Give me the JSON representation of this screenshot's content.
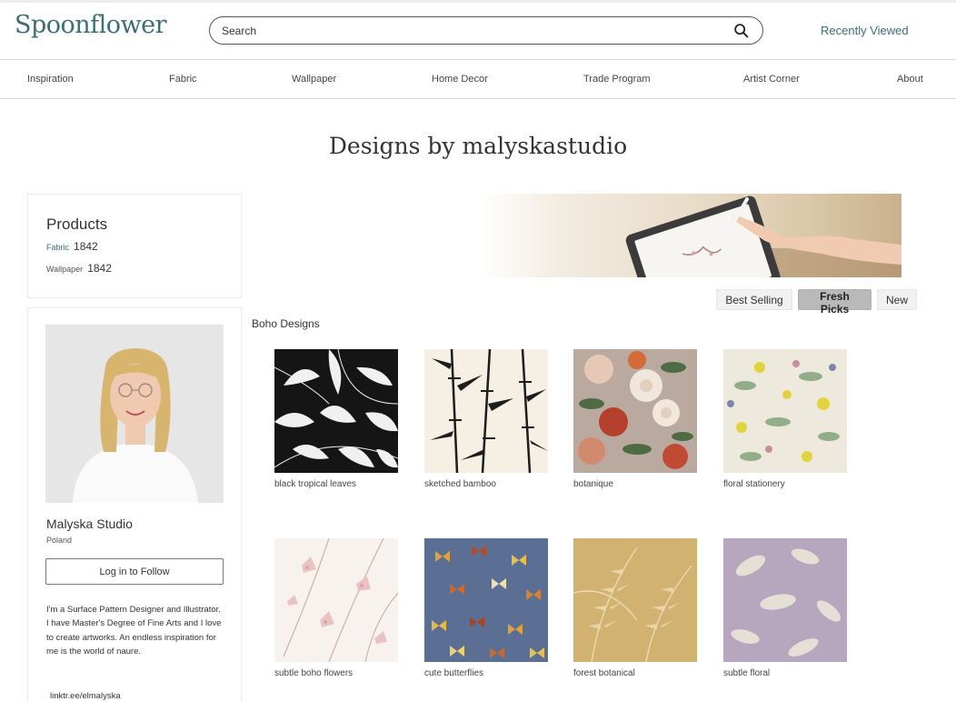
{
  "header": {
    "logo": "Spoonflower",
    "search_placeholder": "Search",
    "recently_viewed": "Recently Viewed"
  },
  "nav": [
    "Inspiration",
    "Fabric",
    "Wallpaper",
    "Home Decor",
    "Trade Program",
    "Artist Corner",
    "About"
  ],
  "page_title": "Designs by malyskastudio",
  "products": {
    "heading": "Products",
    "rows": [
      {
        "label": "Fabric",
        "count": "1842"
      },
      {
        "label": "Wallpaper",
        "count": "1842"
      }
    ]
  },
  "profile": {
    "name": "Malyska Studio",
    "country": "Poland",
    "follow_label": "Log in to Follow",
    "bio": "I'm a Surface Pattern Designer and Illustrator. I have Master's Degree of Fine Arts and I love to create artworks. An endless inspiration for me is the world of naure.",
    "link": "linktr.ee/elmalyska"
  },
  "sort": [
    "Best Selling",
    "Fresh Picks",
    "New"
  ],
  "sort_active": "Fresh Picks",
  "section_title": "Boho Designs",
  "designs": [
    {
      "title": "black tropical leaves"
    },
    {
      "title": "sketched bamboo"
    },
    {
      "title": "botanique"
    },
    {
      "title": "floral stationery"
    },
    {
      "title": "subtle boho flowers"
    },
    {
      "title": "cute butterflies"
    },
    {
      "title": "forest botanical"
    },
    {
      "title": "subtle floral"
    }
  ],
  "colors": {
    "brand": "#3c6e73",
    "active_pill": "#b9b9b9",
    "border": "#d8d8d8"
  }
}
